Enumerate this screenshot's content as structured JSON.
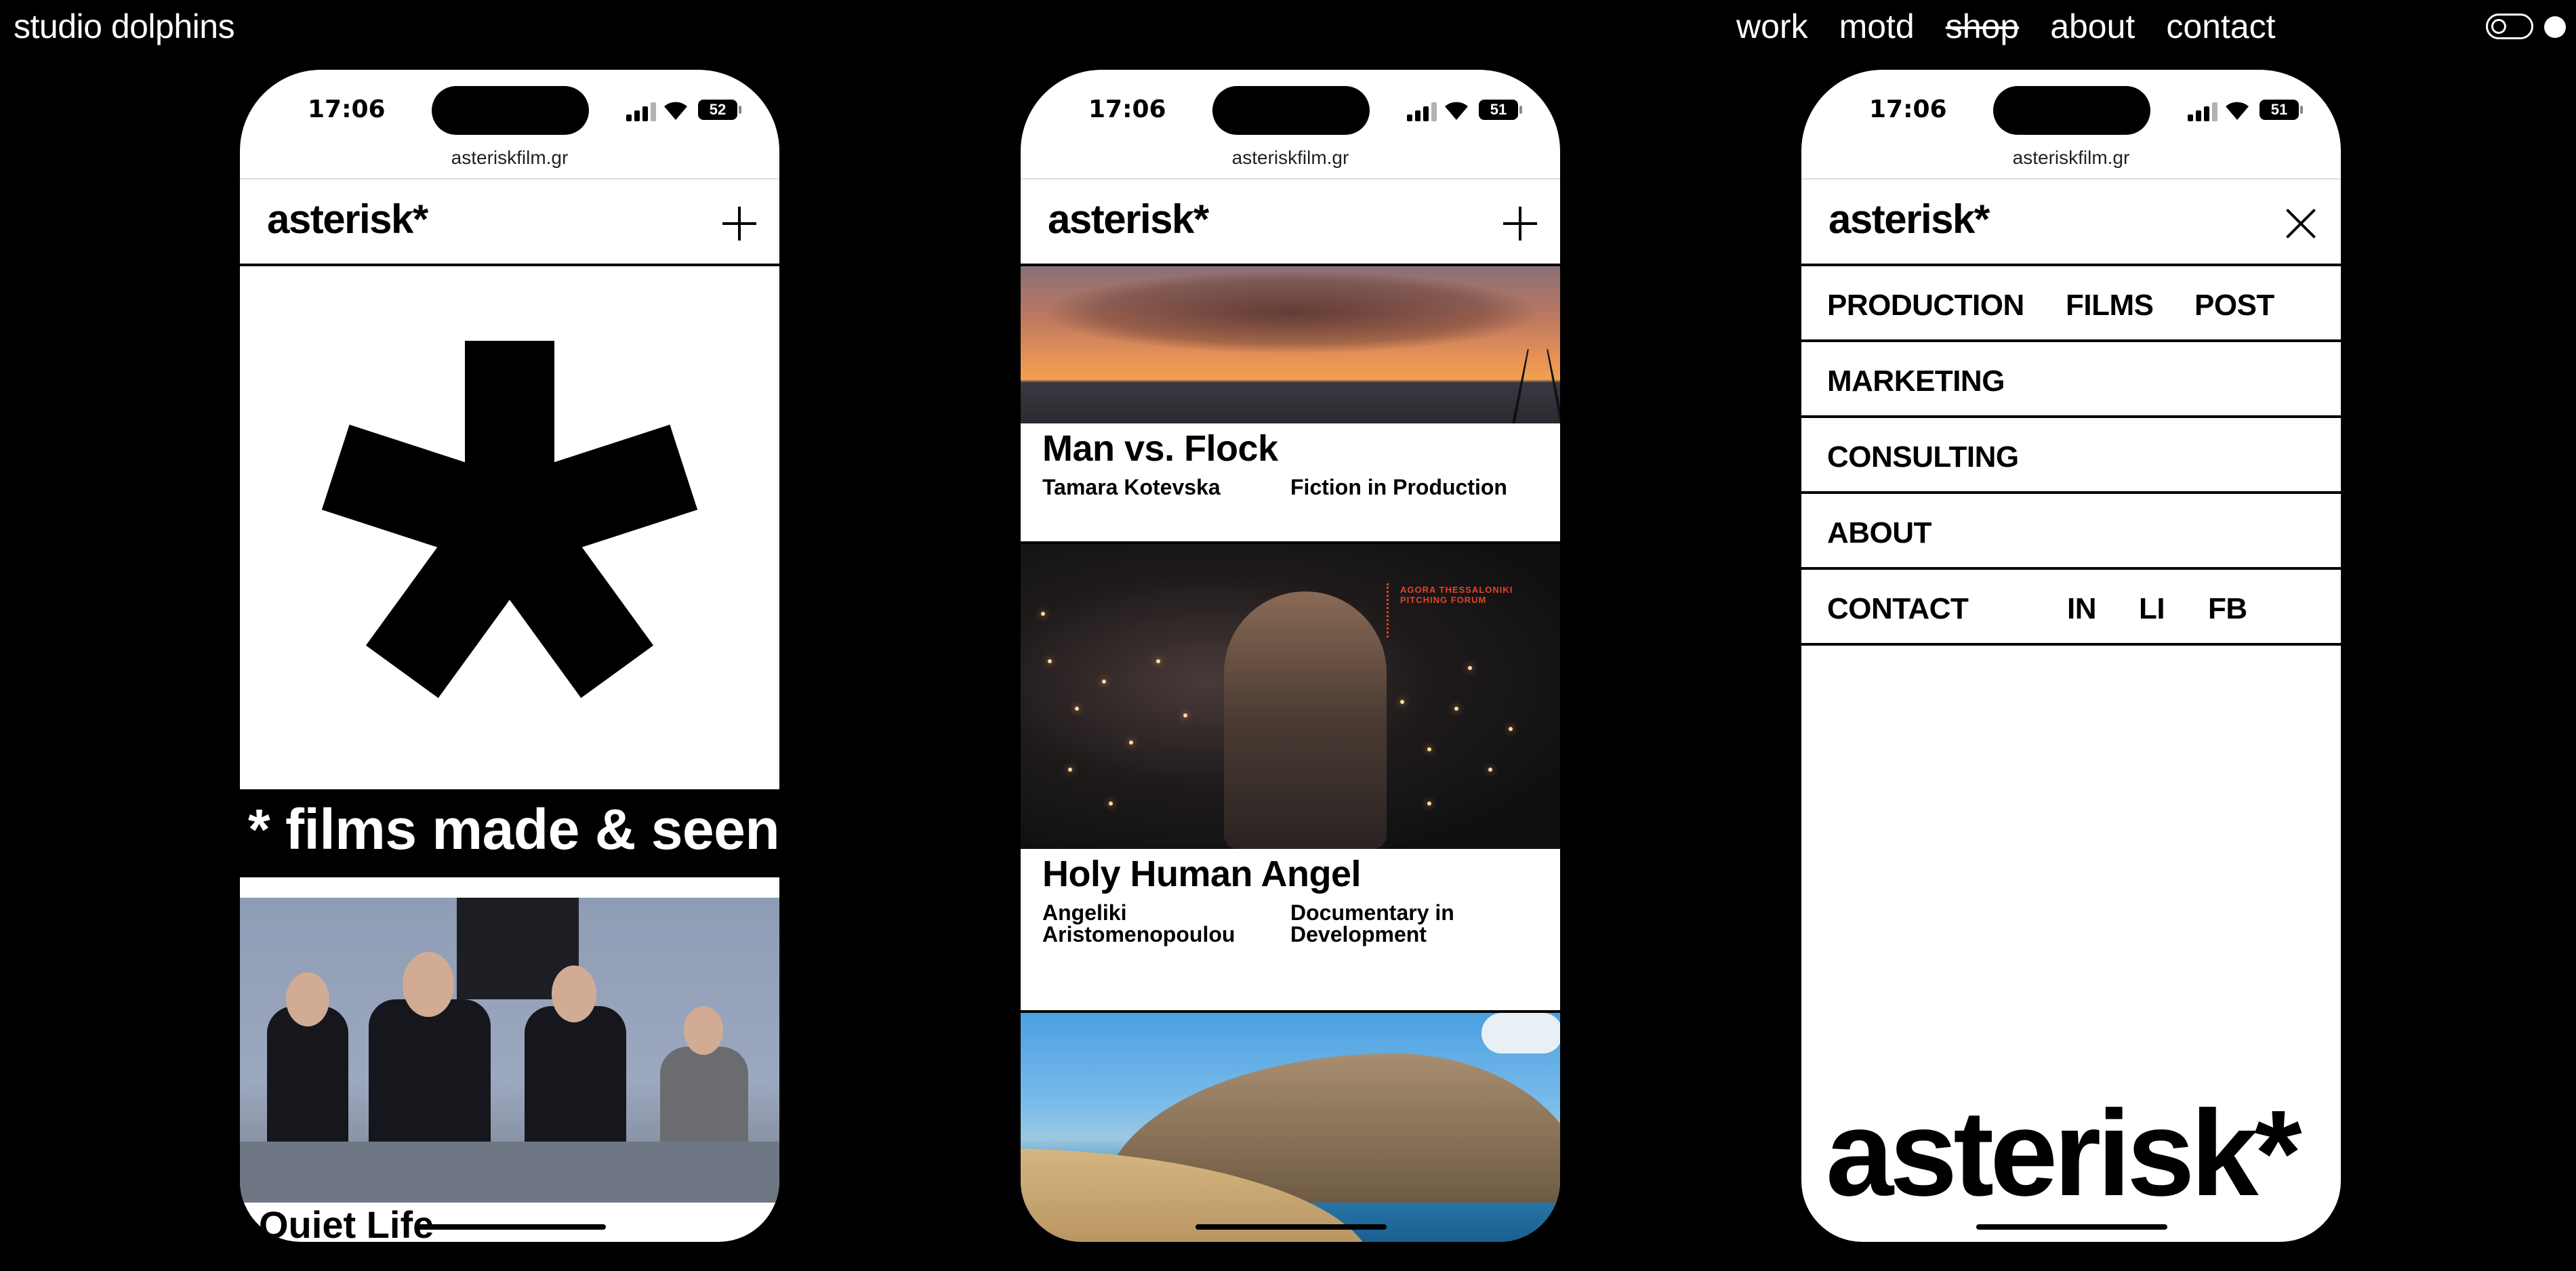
{
  "site": {
    "title": "studio dolphins",
    "nav": [
      "work",
      "motd",
      "shop",
      "about",
      "contact"
    ]
  },
  "phones": [
    {
      "time": "17:06",
      "battery": "52",
      "url": "asteriskfilm.gr",
      "logo": "asterisk*",
      "banner": "* films made & seen",
      "card_title": "Quiet Life"
    },
    {
      "time": "17:06",
      "battery": "51",
      "url": "asteriskfilm.gr",
      "logo": "asterisk*",
      "cards": [
        {
          "title": "Man vs. Flock",
          "director": "Tamara Kotevska",
          "status": "Fiction in Production"
        },
        {
          "title": "Holy Human Angel",
          "director": "Angeliki Aristomenopoulou",
          "status": "Documentary in Development",
          "badge": "AGORA THESSALONIKI PITCHING FORUM"
        }
      ]
    },
    {
      "time": "17:06",
      "battery": "51",
      "url": "asteriskfilm.gr",
      "logo": "asterisk*",
      "menu": {
        "row1": [
          "PRODUCTION",
          "FILMS",
          "POST"
        ],
        "marketing": "MARKETING",
        "consulting": "CONSULTING",
        "about": "ABOUT",
        "contact": "CONTACT",
        "social": [
          "IN",
          "LI",
          "FB"
        ]
      },
      "footer_logo": "asterisk*"
    }
  ]
}
